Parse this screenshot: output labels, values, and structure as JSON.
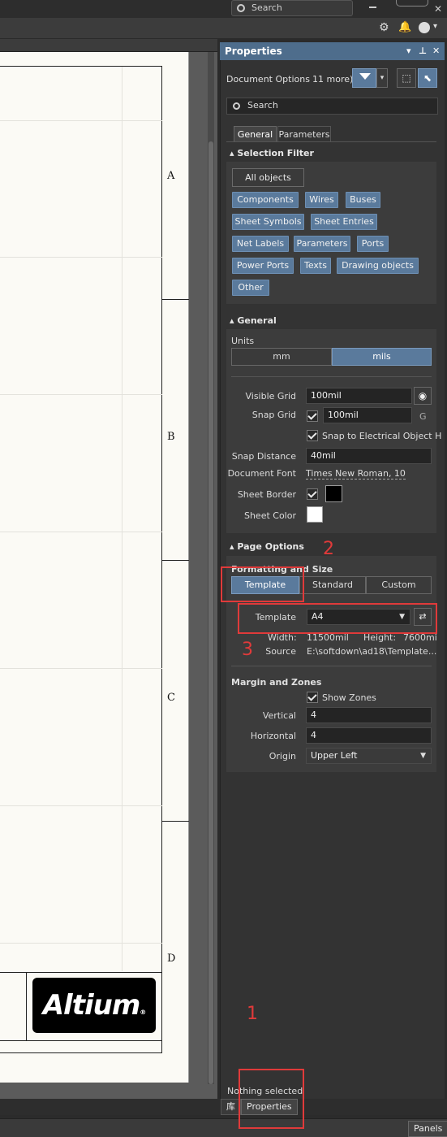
{
  "top": {
    "search_placeholder": "Search"
  },
  "sheet": {
    "zones": [
      "A",
      "B",
      "C",
      "D"
    ],
    "logo_text": "Altium"
  },
  "panel": {
    "title": "Properties",
    "doc_options": "Document Options",
    "more": "11 more)",
    "search_placeholder": "Search",
    "tabs": [
      "General",
      "Parameters"
    ],
    "selection_filter": {
      "title": "Selection Filter",
      "all": "All objects",
      "items": [
        "Components",
        "Wires",
        "Buses",
        "Sheet Symbols",
        "Sheet Entries",
        "Net Labels",
        "Parameters",
        "Ports",
        "Power Ports",
        "Texts",
        "Drawing objects",
        "Other"
      ]
    },
    "general": {
      "title": "General",
      "units_label": "Units",
      "units": [
        "mm",
        "mils"
      ],
      "visible_grid_label": "Visible Grid",
      "visible_grid": "100mil",
      "snap_grid_label": "Snap Grid",
      "snap_grid": "100mil",
      "snap_grid_key": "G",
      "snap_electrical": "Snap to Electrical Object H",
      "snap_distance_label": "Snap Distance",
      "snap_distance": "40mil",
      "document_font_label": "Document Font",
      "document_font": "Times New Roman, 10",
      "sheet_border_label": "Sheet Border",
      "sheet_color_label": "Sheet Color",
      "sheet_border_color": "#000000",
      "sheet_color": "#ffffff"
    },
    "page_options": {
      "title": "Page Options",
      "formatting_label": "Formatting and Size",
      "modes": [
        "Template",
        "Standard",
        "Custom"
      ],
      "template_label": "Template",
      "template_value": "A4",
      "width_label": "Width:",
      "width_value": "11500mil",
      "height_label": "Height:",
      "height_value": "7600mi",
      "source_label": "Source",
      "source_value": "E:\\softdown\\ad18\\Template...",
      "margin_title": "Margin and Zones",
      "show_zones": "Show Zones",
      "vertical_label": "Vertical",
      "vertical_value": "4",
      "horizontal_label": "Horizontal",
      "horizontal_value": "4",
      "origin_label": "Origin",
      "origin_value": "Upper Left"
    },
    "status": "Nothing selected"
  },
  "bottom": {
    "lib_tab": "库",
    "properties_tab": "Properties",
    "panels": "Panels"
  },
  "annotations": [
    "1",
    "2",
    "3"
  ],
  "colors": {
    "accent": "#5a7a9c",
    "header": "#4e6d8c",
    "annotation": "#e03a3a"
  }
}
